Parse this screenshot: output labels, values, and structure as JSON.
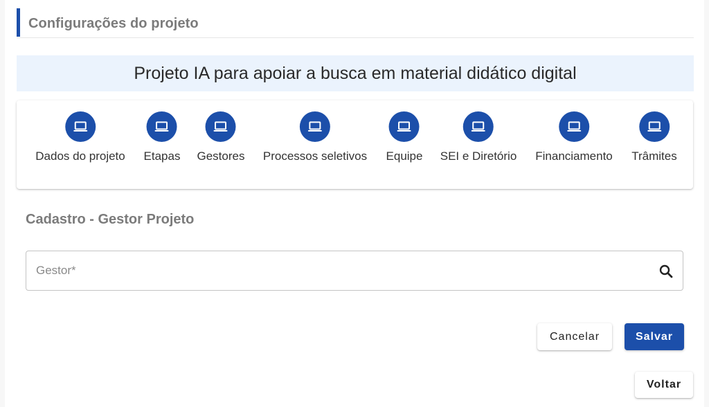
{
  "header": {
    "title": "Configurações do projeto"
  },
  "project": {
    "name": "Projeto IA para apoiar a busca em material didático digital"
  },
  "steps": [
    {
      "label": "Dados do projeto",
      "icon": "laptop-icon"
    },
    {
      "label": "Etapas",
      "icon": "laptop-icon"
    },
    {
      "label": "Gestores",
      "icon": "laptop-icon"
    },
    {
      "label": "Processos seletivos",
      "icon": "laptop-icon"
    },
    {
      "label": "Equipe",
      "icon": "laptop-icon"
    },
    {
      "label": "SEI e Diretório",
      "icon": "laptop-icon"
    },
    {
      "label": "Financiamento",
      "icon": "laptop-icon"
    },
    {
      "label": "Trâmites",
      "icon": "laptop-icon"
    }
  ],
  "form": {
    "title": "Cadastro - Gestor Projeto",
    "gestor": {
      "placeholder": "Gestor*",
      "value": ""
    },
    "cancel_label": "Cancelar",
    "save_label": "Salvar"
  },
  "footer": {
    "back_label": "Voltar"
  },
  "colors": {
    "primary": "#1c4faa",
    "banner_bg": "#ebf3fd",
    "section_title": "#7b7b7b"
  }
}
